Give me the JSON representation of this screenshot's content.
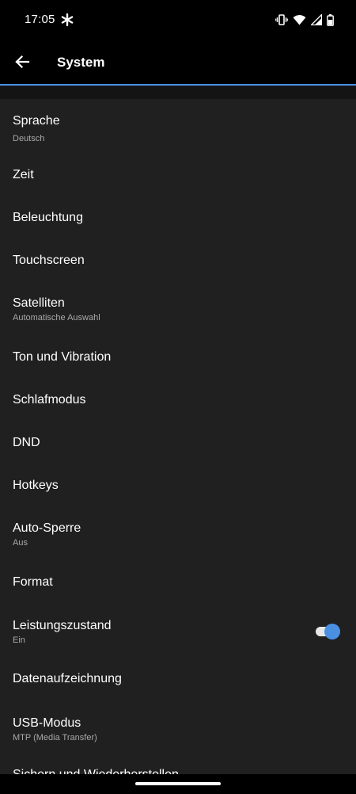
{
  "status_bar": {
    "time": "17:05",
    "icons": [
      "asterisk-icon",
      "vibrate-icon",
      "wifi-icon",
      "signal-icon",
      "battery-icon"
    ]
  },
  "app_bar": {
    "back_icon": "arrow-left-icon",
    "title": "System"
  },
  "settings": [
    {
      "title": "Sprache",
      "subtitle": "Deutsch"
    },
    {
      "title": "Zeit"
    },
    {
      "title": "Beleuchtung"
    },
    {
      "title": "Touchscreen"
    },
    {
      "title": "Satelliten",
      "subtitle": "Automatische Auswahl"
    },
    {
      "title": "Ton und Vibration"
    },
    {
      "title": "Schlafmodus"
    },
    {
      "title": "DND"
    },
    {
      "title": "Hotkeys"
    },
    {
      "title": "Auto-Sperre",
      "subtitle": "Aus"
    },
    {
      "title": "Format"
    },
    {
      "title": "Leistungszustand",
      "subtitle": "Ein",
      "toggle": true
    },
    {
      "title": "Datenaufzeichnung"
    },
    {
      "title": "USB-Modus",
      "subtitle": "MTP (Media Transfer)"
    },
    {
      "title": "Sichern und Wiederherstellen"
    }
  ],
  "colors": {
    "accent": "#4a90e2",
    "list_background": "#202020",
    "subtitle_text": "#a8a8a8"
  }
}
